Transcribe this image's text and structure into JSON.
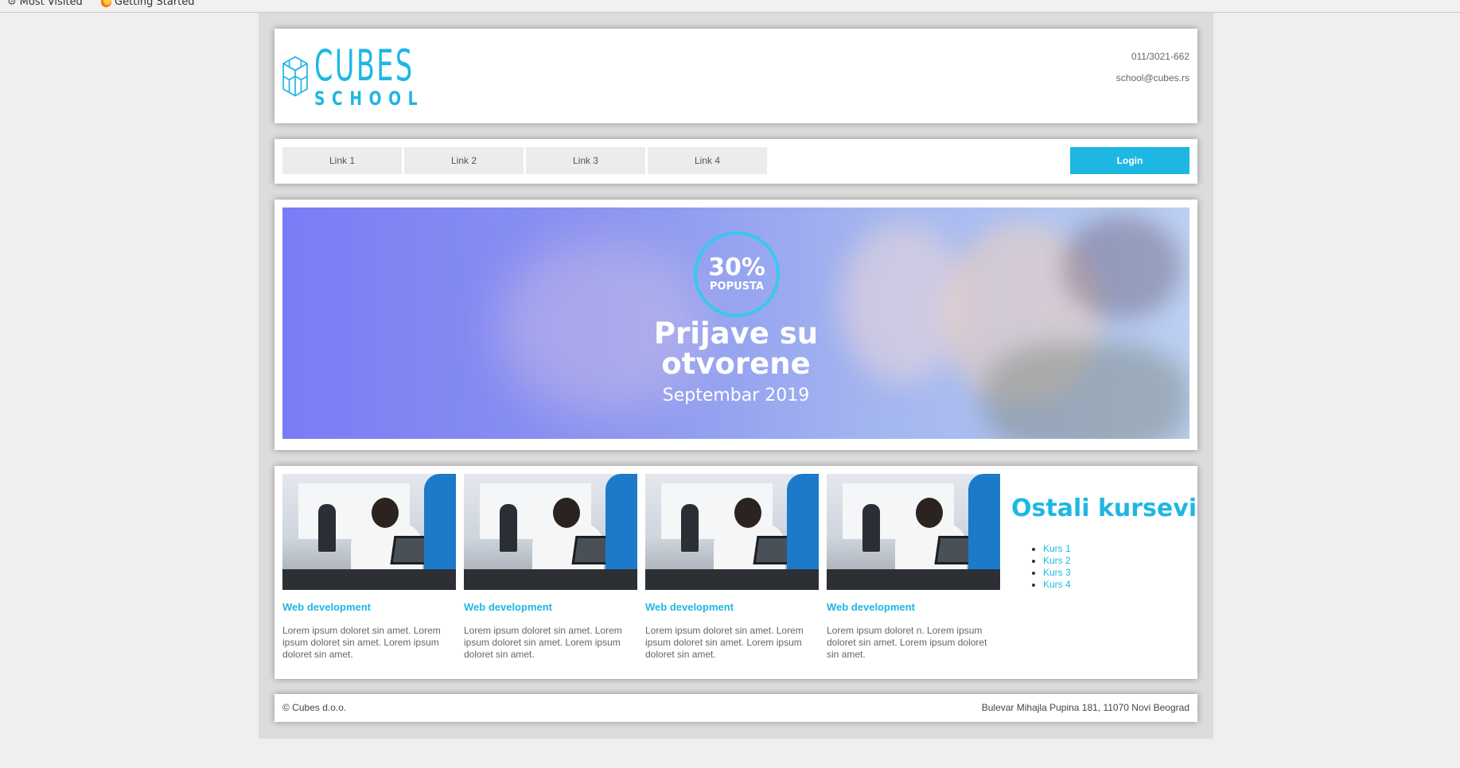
{
  "bookmarks": [
    {
      "icon": "gear-icon",
      "label": "Most Visited"
    },
    {
      "icon": "firefox-icon",
      "label": "Getting Started"
    }
  ],
  "header": {
    "logo_top": "CUBES",
    "logo_bottom": "SCHOOL",
    "phone": "011/3021-662",
    "email": "school@cubes.rs"
  },
  "nav": {
    "links": [
      "Link 1",
      "Link 2",
      "Link 3",
      "Link 4"
    ],
    "login_label": "Login"
  },
  "hero": {
    "badge_percent": "30%",
    "badge_text": "POPUSTA",
    "title_line1": "Prijave su",
    "title_line2": "otvorene",
    "subtitle": "Septembar 2019"
  },
  "courses": [
    {
      "title": "Web development",
      "text": "Lorem ipsum doloret sin amet. Lorem ipsum doloret sin amet. Lorem ipsum doloret sin amet."
    },
    {
      "title": "Web development",
      "text": "Lorem ipsum doloret sin amet. Lorem ipsum doloret sin amet. Lorem ipsum doloret sin amet."
    },
    {
      "title": "Web development",
      "text": "Lorem ipsum doloret sin amet. Lorem ipsum doloret sin amet. Lorem ipsum doloret sin amet."
    },
    {
      "title": "Web development",
      "text": "Lorem ipsum doloret n. Lorem ipsum doloret sin amet. Lorem ipsum doloret sin amet."
    }
  ],
  "aside": {
    "title": "Ostali kursevi",
    "items": [
      "Kurs 1",
      "Kurs 2",
      "Kurs 3",
      "Kurs 4"
    ]
  },
  "footer": {
    "copyright": "© Cubes d.o.o.",
    "address": "Bulevar Mihajla Pupina 181, 11070 Novi Beograd"
  },
  "colors": {
    "accent": "#1eb7e3",
    "nav_link_bg": "#ececec",
    "page_bg": "#efefef",
    "wrap_bg": "#dcdcdc"
  }
}
